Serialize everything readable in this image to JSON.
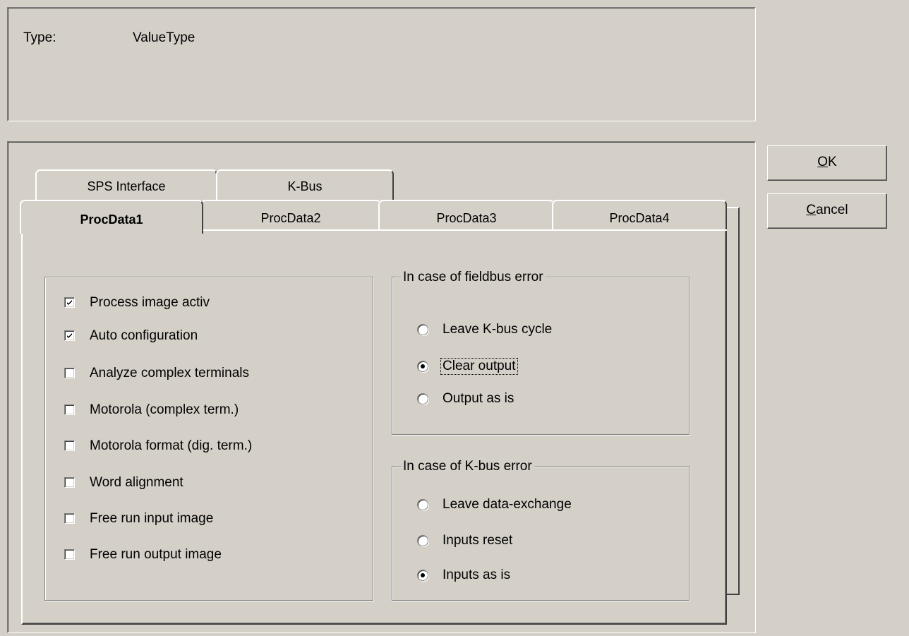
{
  "info": {
    "type_label": "Type:",
    "type_value": "ValueType"
  },
  "buttons": {
    "ok": "OK",
    "ok_mnemonic": "O",
    "ok_rest": "K",
    "cancel_mnemonic": "C",
    "cancel_rest": "ancel"
  },
  "tabs_back": [
    "SPS Interface",
    "K-Bus"
  ],
  "tabs_front": [
    "ProcData1",
    "ProcData2",
    "ProcData3",
    "ProcData4"
  ],
  "selected_tab": "ProcData1",
  "options": [
    {
      "label": "Process image activ",
      "checked": true
    },
    {
      "label": "Auto configuration",
      "checked": true
    },
    {
      "label": "Analyze complex terminals",
      "checked": false
    },
    {
      "label": "Motorola (complex term.)",
      "checked": false
    },
    {
      "label": "Motorola format (dig. term.)",
      "checked": false
    },
    {
      "label": "Word alignment",
      "checked": false
    },
    {
      "label": "Free run input image",
      "checked": false
    },
    {
      "label": "Free run output image",
      "checked": false
    }
  ],
  "fieldbus_group": {
    "title": "In case of fieldbus error",
    "options": [
      {
        "label": "Leave K-bus cycle",
        "selected": false
      },
      {
        "label": "Clear output",
        "selected": true
      },
      {
        "label": "Output as is",
        "selected": false
      }
    ]
  },
  "kbus_group": {
    "title": "In case of K-bus error",
    "options": [
      {
        "label": "Leave data-exchange",
        "selected": false
      },
      {
        "label": "Inputs reset",
        "selected": false
      },
      {
        "label": "Inputs as is",
        "selected": true
      }
    ]
  }
}
